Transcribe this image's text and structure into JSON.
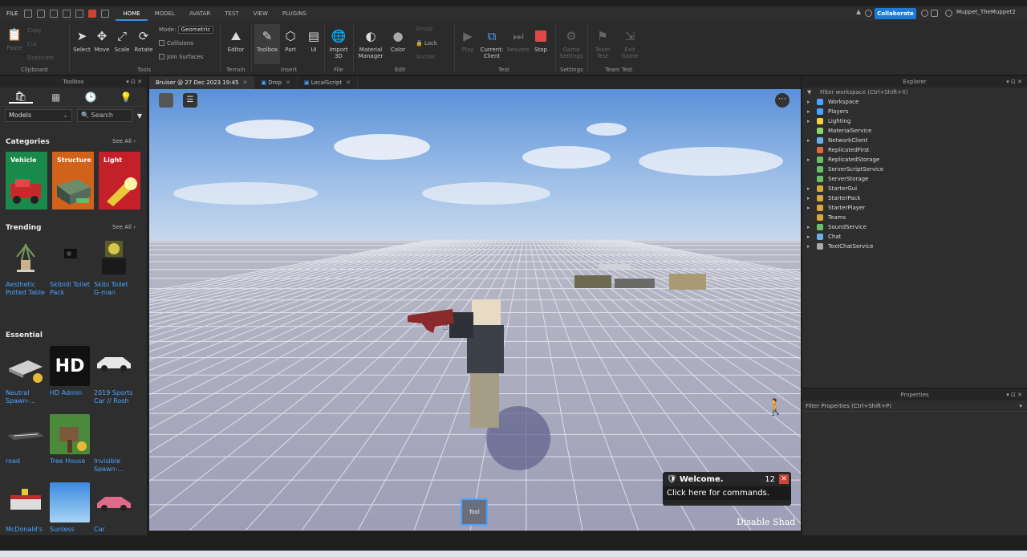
{
  "menubar": {
    "file": "FILE",
    "tabs": [
      "HOME",
      "MODEL",
      "AVATAR",
      "TEST",
      "VIEW",
      "PLUGINS"
    ],
    "active_tab": "HOME",
    "collaborate": "Collaborate",
    "user": "Muppet_TheMuppet2"
  },
  "ribbon": {
    "clipboard": {
      "paste": "Paste",
      "copy": "Copy",
      "cut": "Cut",
      "duplicate": "Duplicate",
      "label": "Clipboard"
    },
    "tools": {
      "select": "Select",
      "move": "Move",
      "scale": "Scale",
      "rotate": "Rotate",
      "mode_label": "Mode:",
      "mode_value": "Geometric",
      "collisions": "Collisions",
      "join_surfaces": "Join Surfaces",
      "label": "Tools"
    },
    "terrain": {
      "editor": "Editor",
      "label": "Terrain"
    },
    "insert": {
      "toolbox": "Toolbox",
      "part": "Part",
      "ui": "UI",
      "label": "Insert"
    },
    "file": {
      "import3d": "Import 3D",
      "label": "File"
    },
    "edit": {
      "material_manager": "Material Manager",
      "color": "Color",
      "group": "Group",
      "lock": "Lock",
      "anchor": "Anchor",
      "label": "Edit"
    },
    "test": {
      "play": "Play",
      "current_client": "Current: Client",
      "resume": "Resume",
      "stop": "Stop",
      "label": "Test"
    },
    "settings": {
      "game_settings": "Game Settings",
      "label": "Settings"
    },
    "teamtest": {
      "team_test": "Team Test",
      "exit_game": "Exit Game",
      "label": "Team Test"
    }
  },
  "toolbox": {
    "title": "Toolbox",
    "filter_value": "Models",
    "search_placeholder": "Search",
    "categories_title": "Categories",
    "see_all": "See All ›",
    "categories": [
      {
        "label": "Vehicle",
        "color": "#1a8a4a"
      },
      {
        "label": "Structure",
        "color": "#d1621a"
      },
      {
        "label": "Light",
        "color": "#c4202a"
      }
    ],
    "trending_title": "Trending",
    "trending": [
      {
        "name": "Aesthetic Potted Table"
      },
      {
        "name": "Skibidi Toilet Pack"
      },
      {
        "name": "Skibi Toilet G-man"
      }
    ],
    "essential_title": "Essential",
    "essential": [
      {
        "name": "Neutral Spawn-..."
      },
      {
        "name": "HD Admin",
        "thumb_text": "HD"
      },
      {
        "name": "2019 Sports Car // Rosh"
      },
      {
        "name": "road"
      },
      {
        "name": "Tree House"
      },
      {
        "name": "Invisible Spawn-..."
      },
      {
        "name": "McDonald's"
      },
      {
        "name": "Sunless"
      },
      {
        "name": "Car"
      }
    ]
  },
  "doctabs": [
    {
      "label": "Bruiser @ 27 Dec 2023 19:45",
      "active": true
    },
    {
      "label": "Drop",
      "active": false
    },
    {
      "label": "LocalScript",
      "active": false
    }
  ],
  "viewport": {
    "tool_label": "Tool",
    "chat_title": "Welcome.",
    "chat_count": "12",
    "chat_prompt": "Click here for commands.",
    "disable_text": "Disable Shad"
  },
  "explorer": {
    "title": "Explorer",
    "filter_placeholder": "Filter workspace (Ctrl+Shift+X)",
    "items": [
      {
        "label": "Workspace",
        "expandable": true,
        "icon_color": "#4aa3ff"
      },
      {
        "label": "Players",
        "expandable": true,
        "icon_color": "#4aa3ff"
      },
      {
        "label": "Lighting",
        "expandable": true,
        "icon_color": "#f2d33a"
      },
      {
        "label": "MaterialService",
        "expandable": false,
        "icon_color": "#8bd36a"
      },
      {
        "label": "NetworkClient",
        "expandable": true,
        "icon_color": "#6ab0e8"
      },
      {
        "label": "ReplicatedFirst",
        "expandable": false,
        "icon_color": "#e06a3a"
      },
      {
        "label": "ReplicatedStorage",
        "expandable": true,
        "icon_color": "#6ac06a"
      },
      {
        "label": "ServerScriptService",
        "expandable": false,
        "icon_color": "#6ac06a"
      },
      {
        "label": "ServerStorage",
        "expandable": false,
        "icon_color": "#6ac06a"
      },
      {
        "label": "StarterGui",
        "expandable": true,
        "icon_color": "#d8a83a"
      },
      {
        "label": "StarterPack",
        "expandable": true,
        "icon_color": "#d8a83a"
      },
      {
        "label": "StarterPlayer",
        "expandable": true,
        "icon_color": "#d8a83a"
      },
      {
        "label": "Teams",
        "expandable": false,
        "icon_color": "#d8a83a"
      },
      {
        "label": "SoundService",
        "expandable": true,
        "icon_color": "#6ac06a"
      },
      {
        "label": "Chat",
        "expandable": true,
        "icon_color": "#6ab0e8"
      },
      {
        "label": "TextChatService",
        "expandable": true,
        "icon_color": "#aaaaaa"
      }
    ]
  },
  "properties": {
    "title": "Properties",
    "filter_placeholder": "Filter Properties (Ctrl+Shift+P)"
  }
}
